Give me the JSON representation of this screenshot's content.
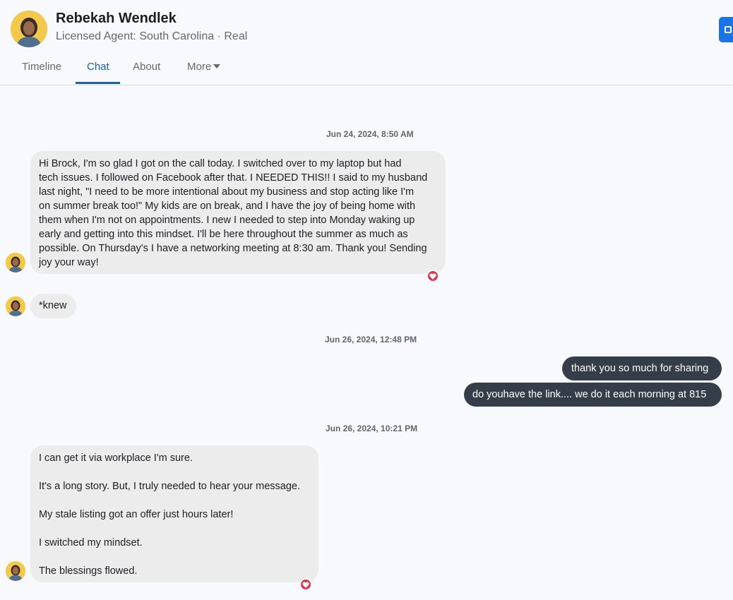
{
  "header": {
    "name": "Rebekah Wendlek",
    "subtitle": "Licensed Agent: South Carolina · Real",
    "tabs": [
      {
        "label": "Timeline"
      },
      {
        "label": "Chat"
      },
      {
        "label": "About"
      },
      {
        "label": "More"
      }
    ],
    "active_tab": "Chat",
    "accent_color": "#1b5fa6"
  },
  "conversation": {
    "timestamps": [
      "Jun 24, 2024, 8:50 AM",
      "Jun 26, 2024, 12:48 PM",
      "Jun 26, 2024, 10:21 PM"
    ],
    "messages": [
      {
        "direction": "incoming",
        "lines": [
          "Hi Brock, I'm so glad I got on the call today. I switched over to my laptop but had",
          "tech issues. I followed on Facebook after that. I NEEDED THIS!! I said to my husband",
          "last night, \"I need to be more intentional about my business and stop acting like I'm",
          "on summer break too!\" My kids are on break, and I have the joy of being home with",
          "them when I'm not on appointments. I new I needed to step into Monday waking up",
          "early and getting into this mindset. I'll be here throughout the summer as much as",
          "possible. On Thursday's I have a networking meeting at 8:30 am. Thank you! Sending",
          "joy your way!"
        ],
        "reaction": "heart-icon"
      },
      {
        "direction": "incoming",
        "text": "*knew"
      },
      {
        "direction": "outgoing",
        "text": "thank you so much for sharing"
      },
      {
        "direction": "outgoing",
        "text": "do youhave the link.... we do it each morning at 815"
      },
      {
        "direction": "incoming",
        "paragraphs": [
          "I can get it via workplace I'm sure.",
          "It's a long story. But, I truly needed to hear your message.",
          "My stale listing got an offer just hours later!",
          "I switched my mindset.",
          "The blessings flowed."
        ],
        "reaction": "heart-icon"
      }
    ]
  },
  "colors": {
    "incoming_bubble": "#ececec",
    "outgoing_bubble": "#343d48",
    "reaction": "#e0314b",
    "page_background": "#f7f9fc"
  }
}
